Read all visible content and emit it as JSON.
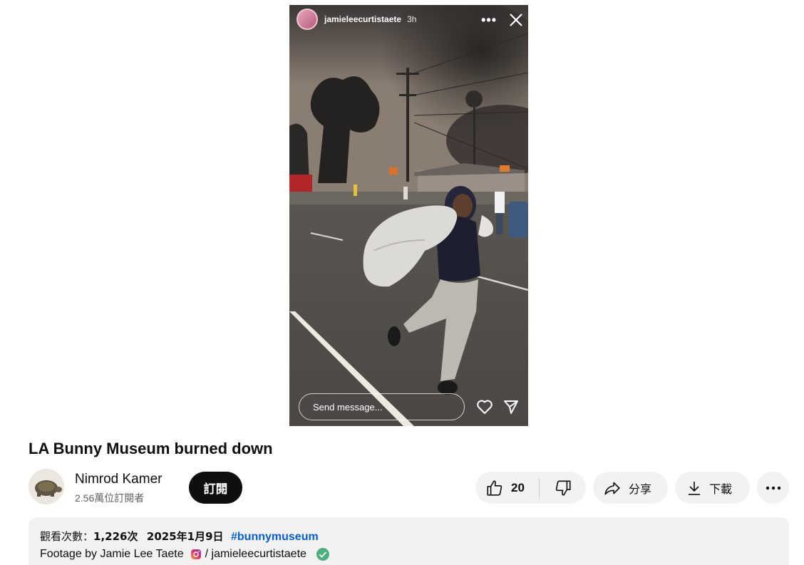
{
  "story": {
    "username": "jamieleecurtistaete",
    "time": "3h",
    "message_placeholder": "Send message..."
  },
  "video": {
    "title": "LA Bunny Museum burned down"
  },
  "channel": {
    "name": "Nimrod Kamer",
    "subscribers": "2.56萬位訂閱者",
    "subscribe_label": "訂閱"
  },
  "actions": {
    "like_count": "20",
    "share_label": "分享",
    "download_label": "下載"
  },
  "description": {
    "views_label": "觀看次數：",
    "views_value": "1,226次",
    "date": "2025年1月9日",
    "hashtag": "#bunnymuseum",
    "credit_text": "Footage by Jamie Lee Taete",
    "credit_handle": "/ jamieleecurtistaete"
  },
  "colors": {
    "accent_link": "#065fd4",
    "subscribe_bg": "#0f0f0f",
    "pill_bg": "#f2f2f2",
    "verified_green": "#4caf80"
  },
  "icons": {
    "like": "thumbs-up-icon",
    "dislike": "thumbs-down-icon",
    "share": "share-arrow-icon",
    "download": "download-icon",
    "more": "more-horizontal-icon",
    "instagram": "instagram-icon",
    "verified": "check-circle-icon"
  }
}
